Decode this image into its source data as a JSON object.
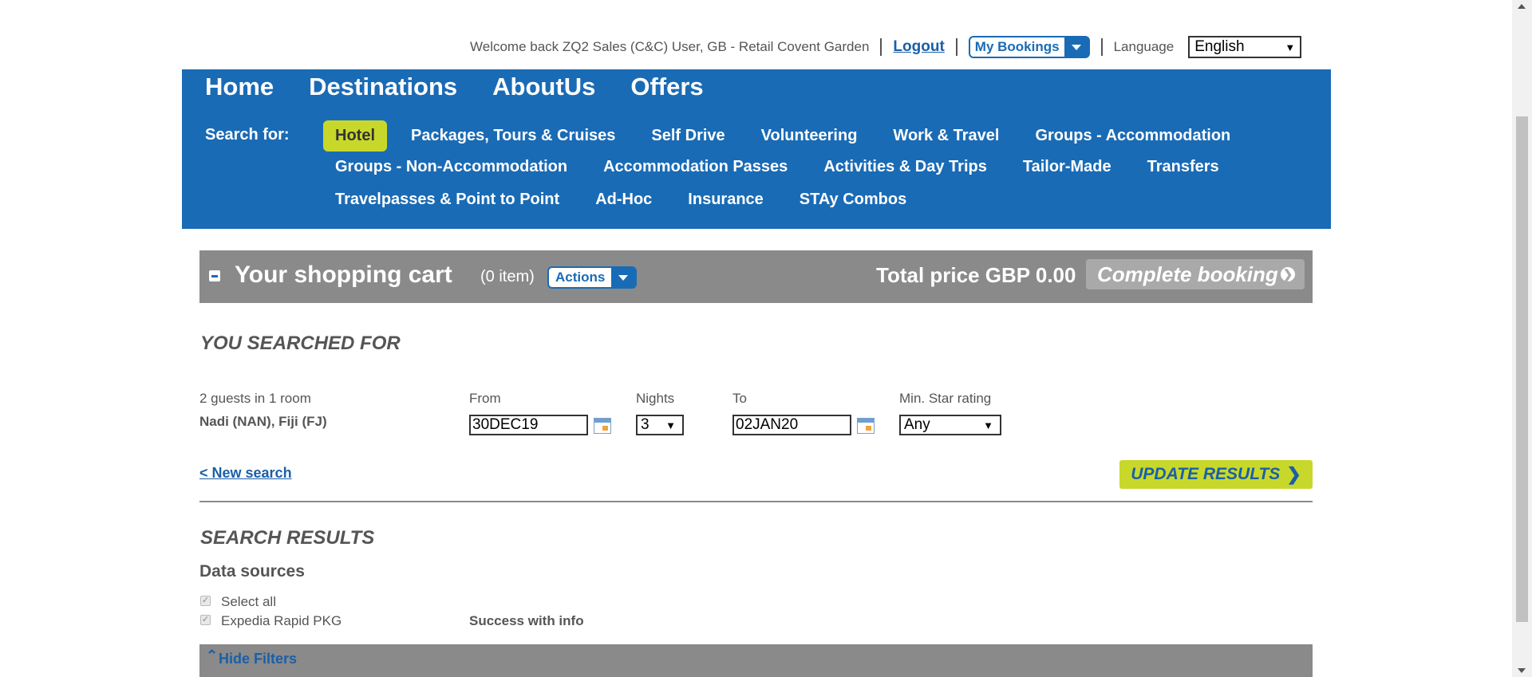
{
  "topbar": {
    "welcome": "Welcome back ZQ2 Sales (C&C) User, GB - Retail Covent Garden",
    "logout": "Logout",
    "my_bookings": "My Bookings",
    "language_label": "Language",
    "language_value": "English"
  },
  "mainnav": [
    "Home",
    "Destinations",
    "AboutUs",
    "Offers"
  ],
  "search_for_label": "Search for:",
  "categories": {
    "row1": [
      "Hotel",
      "Packages, Tours & Cruises",
      "Self Drive",
      "Volunteering",
      "Work & Travel",
      "Groups - Accommodation"
    ],
    "row2": [
      "Groups - Non-Accommodation",
      "Accommodation Passes",
      "Activities & Day Trips",
      "Tailor-Made",
      "Transfers"
    ],
    "row3": [
      "Travelpasses & Point to Point",
      "Ad-Hoc",
      "Insurance",
      "STAy Combos"
    ],
    "active": "Hotel"
  },
  "cart": {
    "title": "Your shopping cart",
    "count": "(0 item)",
    "actions": "Actions",
    "total_label": "Total price",
    "total_value": "GBP 0.00",
    "complete": "Complete booking"
  },
  "search": {
    "heading": "YOU SEARCHED FOR",
    "guests": "2 guests in 1 room",
    "location": "Nadi (NAN), Fiji (FJ)",
    "from_label": "From",
    "from_value": "30DEC19",
    "nights_label": "Nights",
    "nights_value": "3",
    "to_label": "To",
    "to_value": "02JAN20",
    "star_label": "Min. Star rating",
    "star_value": "Any",
    "new_search": "< New search",
    "update": "UPDATE RESULTS"
  },
  "results": {
    "heading": "SEARCH RESULTS",
    "data_sources": "Data sources",
    "select_all": "Select all",
    "source_name": "Expedia Rapid PKG",
    "source_status": "Success with info",
    "hide_filters": "Hide Filters"
  },
  "colors": {
    "nav_blue": "#1a6bb5",
    "accent_lime": "#c8d82a",
    "cart_grey": "#8a8a8a",
    "link_blue": "#1a5fa8"
  }
}
